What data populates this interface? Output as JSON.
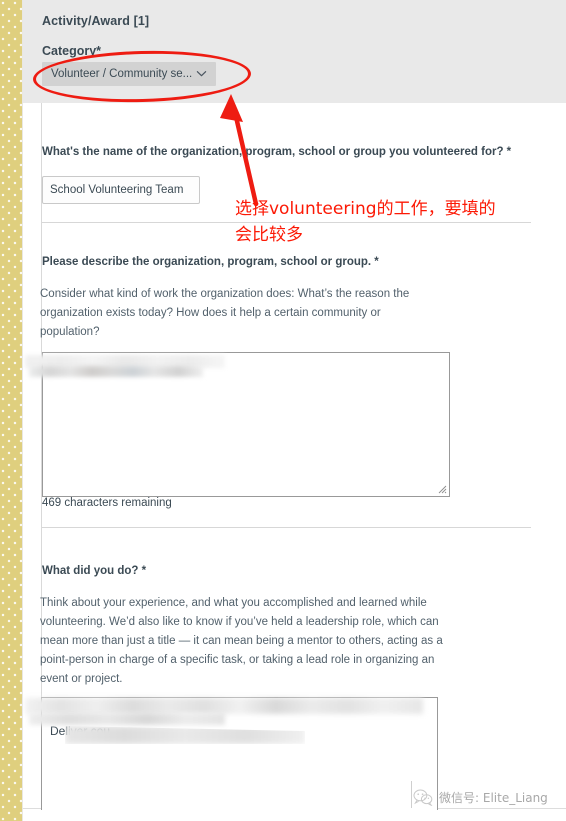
{
  "window": {
    "background_color": "#ffffff",
    "panel_color": "#e9e9e9",
    "stripe_color": "#dfcf7e",
    "text_color": "#3b4a54",
    "annotation_color": "#fc1905"
  },
  "form": {
    "activity_title": "Activity/Award [1]",
    "category": {
      "label": "Category*",
      "selected_value": "Volunteer / Community se...",
      "chevron_icon": "chevron-down-icon"
    },
    "questions": [
      {
        "label": "What's the name of the organization, program, school or group you volunteered for? *",
        "input_value": "School Volunteering Team",
        "input_placeholder": ""
      },
      {
        "label": "Please describe the organization, program, school or group. *",
        "help": "Consider what kind of work the organization does: What’s the reason the organization exists today? How does it help a certain community or population?",
        "textarea_value": "",
        "counter": "469 characters remaining"
      },
      {
        "label": "What did you do? *",
        "help": "Think about your experience, and what you accomplished and learned while volunteering. We’d also like to know if you’ve held a leadership role, which can mean more than just a title — it can mean being a mentor to others, acting as a point-person in charge of a specific task, or taking a lead role in organizing an event or project.",
        "textarea_value": "Deliver cou..."
      }
    ]
  },
  "annotations": {
    "note_line_1": "选择volunteering的工作，要填的",
    "note_line_2": "会比较多",
    "ellipse_target": "category-select",
    "arrow_target": "category-select"
  },
  "watermark": {
    "text": "微信号: Elite_Liang",
    "icon": "wechat-icon"
  }
}
